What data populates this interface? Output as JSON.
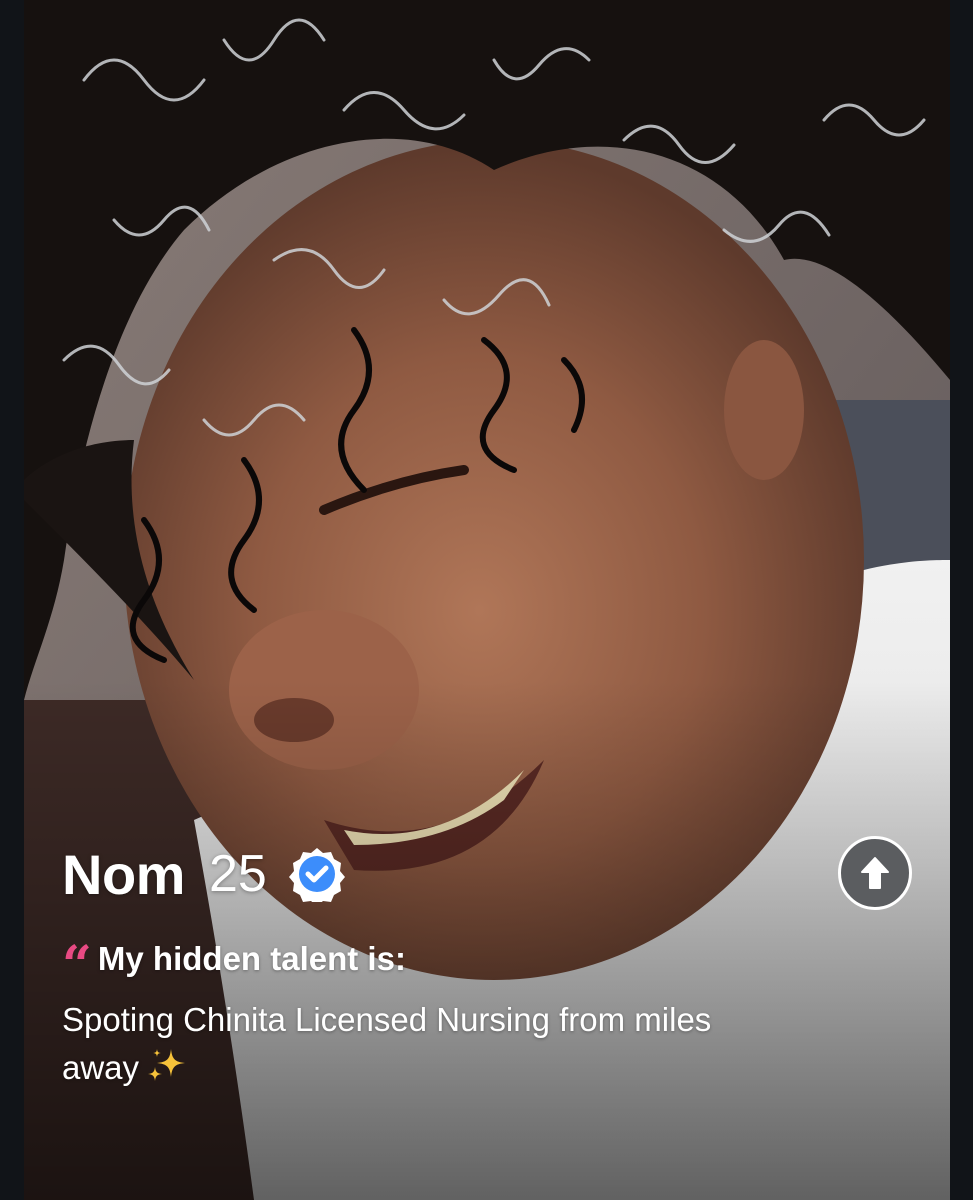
{
  "profile": {
    "name": "Nom",
    "age": "25",
    "verified": true
  },
  "prompt": {
    "label": "My hidden talent is:",
    "answer": "Spoting Chinita Licensed Nursing from miles away"
  },
  "icons": {
    "verified": "verified-badge-icon",
    "quote": "quote-icon",
    "sparkles": "sparkles-icon",
    "expand": "arrow-up-icon"
  },
  "colors": {
    "verified_blue": "#3c8dfb",
    "quote_pink": "#e84a83",
    "expand_button_bg": "#5b5d60"
  }
}
